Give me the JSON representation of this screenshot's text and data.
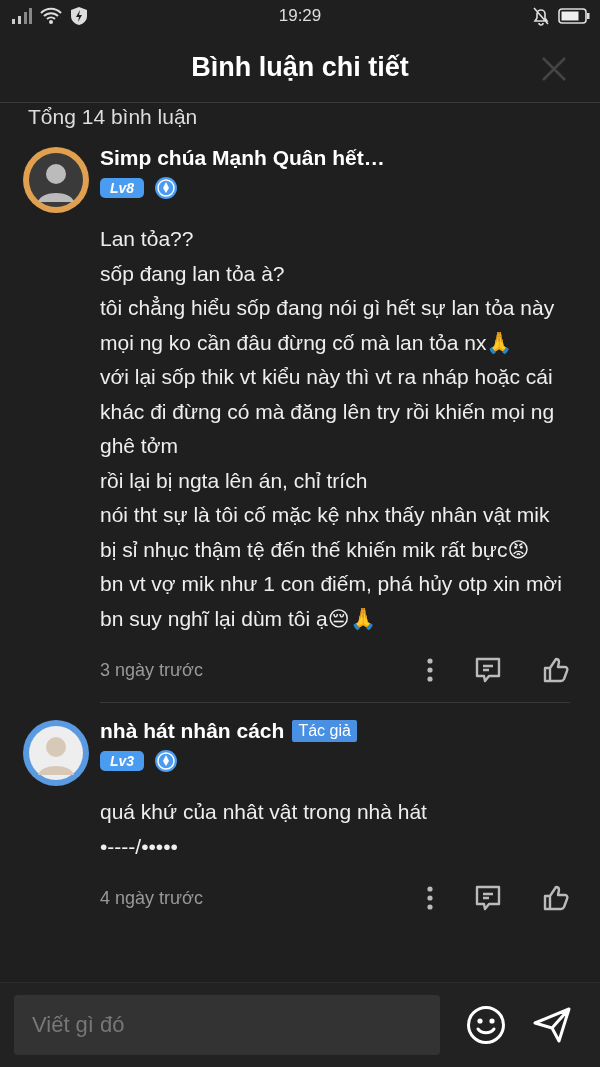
{
  "status_bar": {
    "time": "19:29"
  },
  "header": {
    "title": "Bình luận chi tiết"
  },
  "comment_count": "Tổng 14 bình luận",
  "comments": [
    {
      "author": "Simp chúa Mạnh Quân hết…",
      "level": "Lv8",
      "paragraphs": [
        "Lan tỏa??",
        "sốp đang lan tỏa à?",
        "tôi chẳng hiểu sốp đang nói gì hết sự lan tỏa này mọi ng ko cần đâu đừng cố mà lan tỏa nx🙏",
        "với lại sốp thik vt kiểu này thì vt ra nháp hoặc cái khác đi đừng có mà đăng lên try rồi khiến mọi ng ghê tởm",
        "rồi lại bị ngta lên án, chỉ trích",
        "nói tht sự là tôi cố mặc kệ nhx thấy nhân vật mik bị sỉ nhục thậm tệ đến thế khiến mik rất bực😡",
        "bn vt vợ mik như 1 con điếm, phá hủy otp xin mời bn suy nghĩ lại dùm tôi ạ😔🙏"
      ],
      "time": "3 ngày trước"
    },
    {
      "author": "nhà hát nhân cách",
      "author_tag": "Tác giả",
      "level": "Lv3",
      "paragraphs": [
        "quá khứ của nhât vật trong nhà hát",
        "•----/•••••"
      ],
      "time": "4 ngày trước"
    }
  ],
  "composer": {
    "placeholder": "Viết gì đó"
  }
}
